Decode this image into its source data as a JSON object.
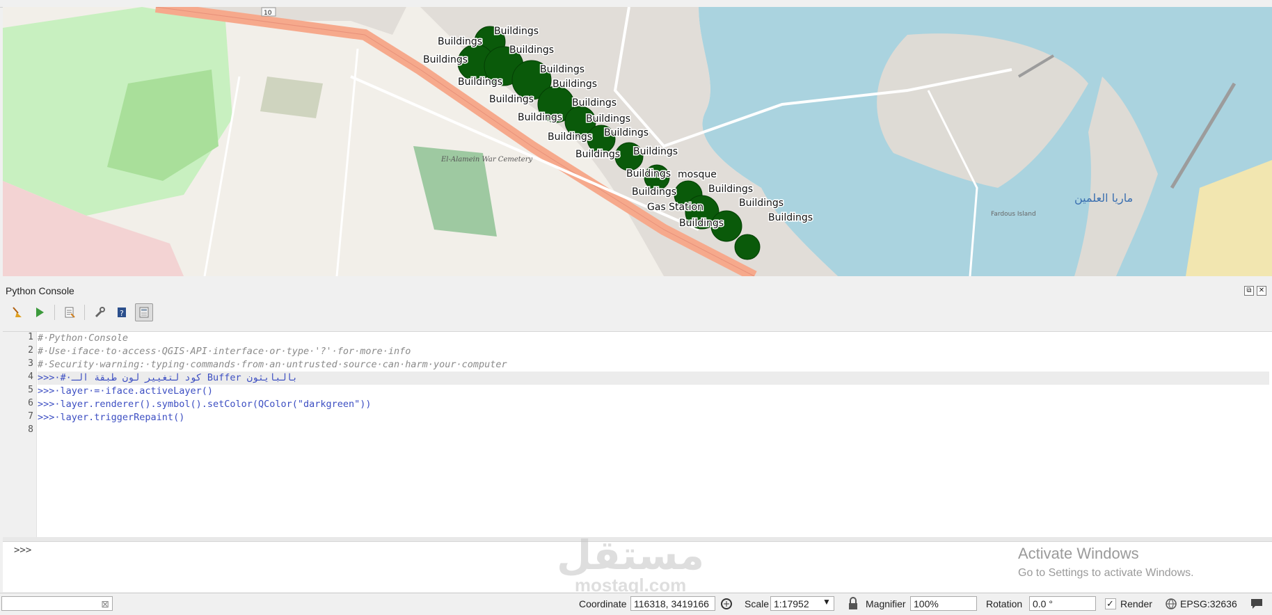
{
  "map": {
    "labels": [
      "Buildings",
      "Buildings",
      "Buildings",
      "Buildings",
      "Buildings",
      "Buildings",
      "Buildings",
      "Buildings",
      "Buildings",
      "Buildings",
      "Buildings",
      "Buildings",
      "Buildings",
      "Buildings",
      "Buildings",
      "Buildings",
      "Buildings",
      "Buildings",
      "Buildings",
      "mosque",
      "Gas Station"
    ],
    "place_labels": [
      "El-Alamein War Cemetery",
      "ماريا العلمين",
      "Fardous Island",
      "10"
    ],
    "buffer_color": "#0a5a0a",
    "water_color": "#aad3df",
    "road_color": "#f6a98c"
  },
  "console": {
    "title": "Python Console",
    "toolbar": {
      "clear_icon": "broom-icon",
      "run_icon": "play-icon",
      "editor_icon": "script-icon",
      "options_icon": "wrench-icon",
      "help_icon": "help-book-icon",
      "toggle_icon": "calculator-icon"
    },
    "lines": [
      {
        "num": "1",
        "text": "#·Python·Console"
      },
      {
        "num": "2",
        "text": "#·Use·iface·to·access·QGIS·API·interface·or·type·'?'·for·more·info"
      },
      {
        "num": "3",
        "text": "#·Security·warning:·typing·commands·from·an·untrusted·source·can·harm·your·computer"
      },
      {
        "num": "4",
        "text": ">>>·#·كود لتغيير لون طبقة الـ Buffer بالبايثون"
      },
      {
        "num": "5",
        "text": ">>>·layer·=·iface.activeLayer()"
      },
      {
        "num": "6",
        "text": ">>>·layer.renderer().symbol().setColor(QColor(\"darkgreen\"))"
      },
      {
        "num": "7",
        "text": ">>>·layer.triggerRepaint()"
      },
      {
        "num": "8",
        "text": ""
      }
    ],
    "input_prompt": ">>>"
  },
  "watermark": {
    "arabic": "مستقل",
    "latin": "mostaql.com"
  },
  "activate": {
    "title": "Activate Windows",
    "subtitle": "Go to Settings to activate Windows."
  },
  "status": {
    "coordinate_label": "Coordinate",
    "coordinate_value": "116318, 3419166",
    "scale_label": "Scale",
    "scale_value": "1:17952",
    "magnifier_label": "Magnifier",
    "magnifier_value": "100%",
    "rotation_label": "Rotation",
    "rotation_value": "0.0 °",
    "render_label": "Render",
    "render_checked": "✓",
    "crs": "EPSG:32636"
  }
}
